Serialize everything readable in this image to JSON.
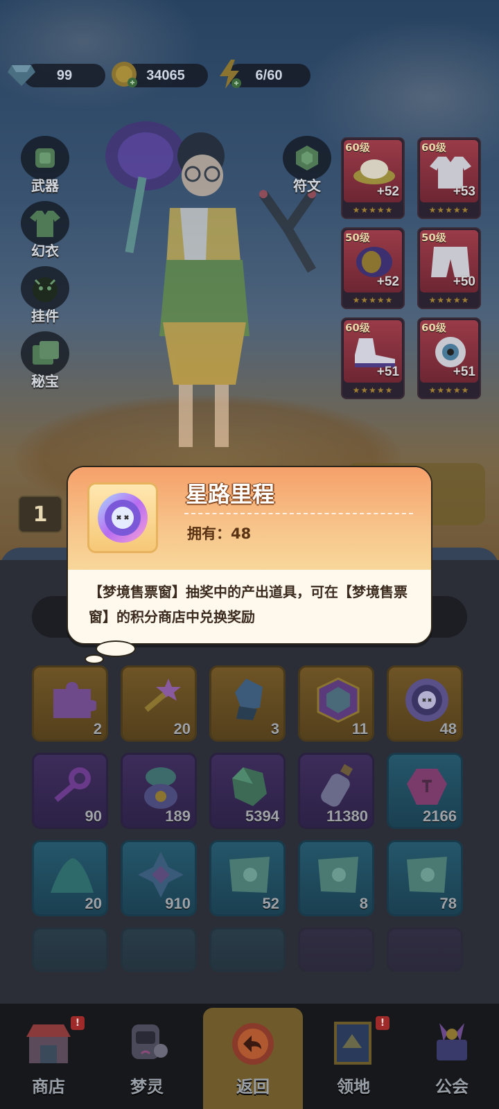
{
  "currency": {
    "gems": "99",
    "coins": "34065",
    "energy": "6/60"
  },
  "side_menu": [
    {
      "label": "武器",
      "icon": "weapon-icon"
    },
    {
      "label": "幻衣",
      "icon": "outfit-icon"
    },
    {
      "label": "挂件",
      "icon": "pendant-icon"
    },
    {
      "label": "秘宝",
      "icon": "treasure-icon"
    }
  ],
  "rune": {
    "label": "符文",
    "icon": "rune-icon"
  },
  "equipment": [
    {
      "level": "60级",
      "plus": "+52",
      "icon": "hat-icon"
    },
    {
      "level": "60级",
      "plus": "+53",
      "icon": "coat-icon"
    },
    {
      "level": "50级",
      "plus": "+52",
      "icon": "bracer-icon"
    },
    {
      "level": "50级",
      "plus": "+50",
      "icon": "pants-icon"
    },
    {
      "level": "60级",
      "plus": "+51",
      "icon": "shoes-icon"
    },
    {
      "level": "60级",
      "plus": "+51",
      "icon": "eye-gear-icon"
    }
  ],
  "level_badge": "1",
  "tooltip": {
    "title": "星路里程",
    "owned_label": "拥有：",
    "owned_count": "48",
    "description": "【梦境售票窗】抽奖中的产出道具，可在【梦境售票窗】的积分商店中兑换奖励",
    "icon": "star-road-token-icon"
  },
  "inventory": [
    [
      {
        "count": "2",
        "icon": "puzzle-piece-icon",
        "tier": "gold"
      },
      {
        "count": "20",
        "icon": "star-key-icon",
        "tier": "gold"
      },
      {
        "count": "3",
        "icon": "crystal-ore-icon",
        "tier": "gold"
      },
      {
        "count": "11",
        "icon": "prism-cube-icon",
        "tier": "gold"
      },
      {
        "count": "48",
        "icon": "star-road-token-icon",
        "tier": "gold"
      }
    ],
    [
      {
        "count": "90",
        "icon": "purple-key-icon",
        "tier": "purple"
      },
      {
        "count": "189",
        "icon": "spirit-pot-icon",
        "tier": "purple"
      },
      {
        "count": "5394",
        "icon": "green-gem-icon",
        "tier": "purple"
      },
      {
        "count": "11380",
        "icon": "potion-bottle-icon",
        "tier": "purple"
      },
      {
        "count": "2166",
        "icon": "pink-stone-icon",
        "tier": "teal"
      }
    ],
    [
      {
        "count": "20",
        "icon": "sand-pile-icon",
        "tier": "teal"
      },
      {
        "count": "910",
        "icon": "rune-fragment-icon",
        "tier": "teal"
      },
      {
        "count": "52",
        "icon": "map-scroll-icon",
        "tier": "teal"
      },
      {
        "count": "8",
        "icon": "map-scroll-icon",
        "tier": "teal"
      },
      {
        "count": "78",
        "icon": "map-scroll-icon",
        "tier": "teal"
      }
    ]
  ],
  "nav": [
    {
      "label": "商店",
      "icon": "shop-icon",
      "badge": "!"
    },
    {
      "label": "梦灵",
      "icon": "dream-spirit-icon",
      "badge": ""
    },
    {
      "label": "返回",
      "icon": "return-icon",
      "badge": ""
    },
    {
      "label": "领地",
      "icon": "territory-icon",
      "badge": "!"
    },
    {
      "label": "公会",
      "icon": "guild-icon",
      "badge": ""
    }
  ],
  "colors": {
    "tooltip_header": "#f6a06a",
    "tooltip_body": "#fff8ec",
    "active_nav": "#6e5a2a"
  }
}
